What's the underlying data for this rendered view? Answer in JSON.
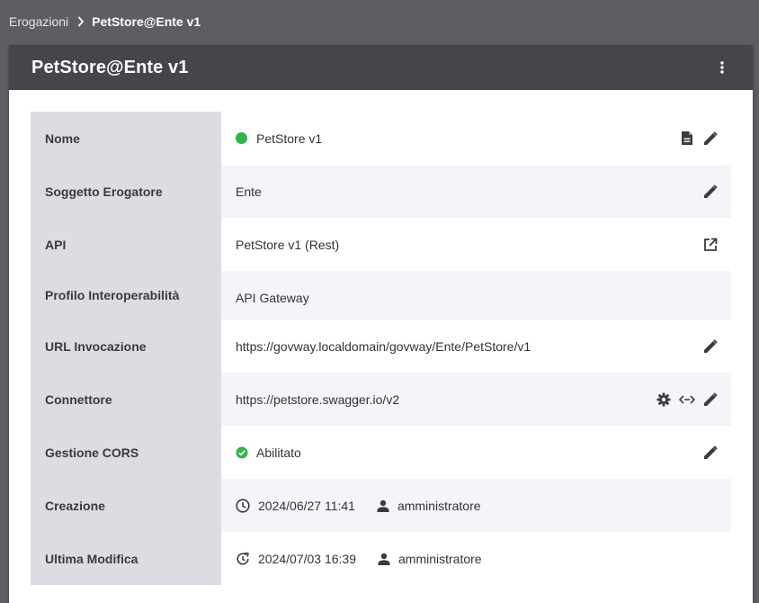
{
  "breadcrumb": {
    "parent": "Erogazioni",
    "current": "PetStore@Ente v1"
  },
  "header": {
    "title": "PetStore@Ente v1",
    "menu_icon": "more-vert-icon"
  },
  "colors": {
    "status_active": "#2fb34a",
    "header_bg": "#45464b",
    "label_bg": "#dcdce3"
  },
  "rows": {
    "nome": {
      "label": "Nome",
      "value": "PetStore v1",
      "status": "active"
    },
    "soggetto": {
      "label": "Soggetto Erogatore",
      "value": "Ente"
    },
    "api": {
      "label": "API",
      "value": "PetStore v1 (Rest)"
    },
    "profilo": {
      "label": "Profilo Interoperabilità",
      "value": "API Gateway"
    },
    "url": {
      "label": "URL Invocazione",
      "value": "https://govway.localdomain/govway/Ente/PetStore/v1"
    },
    "connettore": {
      "label": "Connettore",
      "value": "https://petstore.swagger.io/v2"
    },
    "cors": {
      "label": "Gestione CORS",
      "value": "Abilitato"
    },
    "creazione": {
      "label": "Creazione",
      "date": "2024/06/27 11:41",
      "user": "amministratore"
    },
    "modifica": {
      "label": "Ultima Modifica",
      "date": "2024/07/03 16:39",
      "user": "amministratore"
    }
  }
}
